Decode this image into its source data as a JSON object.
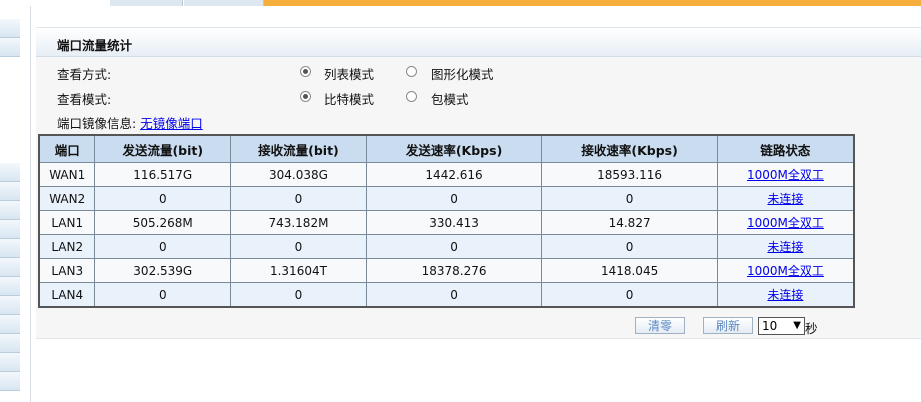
{
  "panel": {
    "title": "端口流量统计"
  },
  "view_mode": {
    "label": "查看方式:",
    "options": [
      "列表模式",
      "图形化模式"
    ],
    "selected": 0
  },
  "view_type": {
    "label": "查看模式:",
    "options": [
      "比特模式",
      "包模式"
    ],
    "selected": 0
  },
  "mirror": {
    "label": "端口镜像信息:",
    "link": "无镜像端口"
  },
  "table": {
    "headers": [
      "端口",
      "发送流量(bit)",
      "接收流量(bit)",
      "发送速率(Kbps)",
      "接收速率(Kbps)",
      "链路状态"
    ],
    "rows": [
      [
        "WAN1",
        "116.517G",
        "304.038G",
        "1442.616",
        "18593.116",
        "1000M全双工"
      ],
      [
        "WAN2",
        "0",
        "0",
        "0",
        "0",
        "未连接"
      ],
      [
        "LAN1",
        "505.268M",
        "743.182M",
        "330.413",
        "14.827",
        "1000M全双工"
      ],
      [
        "LAN2",
        "0",
        "0",
        "0",
        "0",
        "未连接"
      ],
      [
        "LAN3",
        "302.539G",
        "1.31604T",
        "18378.276",
        "1418.045",
        "1000M全双工"
      ],
      [
        "LAN4",
        "0",
        "0",
        "0",
        "0",
        "未连接"
      ]
    ]
  },
  "controls": {
    "clear_label": "清零",
    "refresh_label": "刷新",
    "interval_value": "10",
    "unit_label": "秒"
  },
  "colors": {
    "accent": "#f6ae3c",
    "header_bg": "#c9dcf0",
    "link": "#0000ee"
  }
}
